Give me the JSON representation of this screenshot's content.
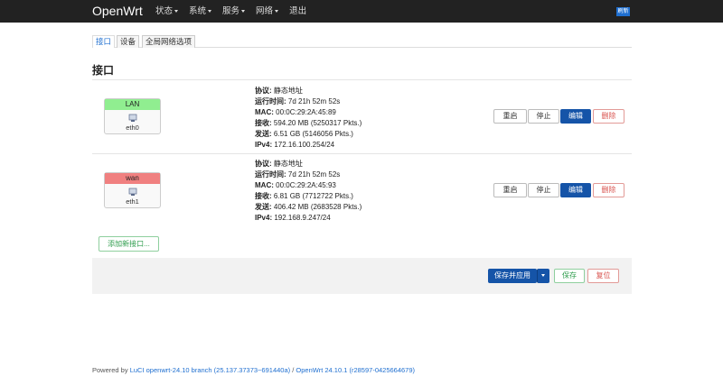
{
  "nav": {
    "brand": "OpenWrt",
    "menu": [
      {
        "label": "状态"
      },
      {
        "label": "系统"
      },
      {
        "label": "服务"
      },
      {
        "label": "网络"
      },
      {
        "label": "退出"
      }
    ],
    "indicator": "刷新"
  },
  "tabs": [
    "接口",
    "设备",
    "全局网络选项"
  ],
  "section_title": "接口",
  "interfaces": [
    {
      "name": "LAN",
      "device": "eth0",
      "color": "#90ee90",
      "protocol_label": "协议:",
      "protocol": "静态地址",
      "uptime_label": "运行时间:",
      "uptime": "7d 21h 52m 52s",
      "mac_label": "MAC:",
      "mac": "00:0C:29:2A:45:89",
      "rx_label": "接收:",
      "rx": "594.20 MB (5250317 Pkts.)",
      "tx_label": "发送:",
      "tx": "6.51 GB (5146056 Pkts.)",
      "ipv4_label": "IPv4:",
      "ipv4": "172.16.100.254/24"
    },
    {
      "name": "wan",
      "device": "eth1",
      "color": "#f08080",
      "protocol_label": "协议:",
      "protocol": "静态地址",
      "uptime_label": "运行时间:",
      "uptime": "7d 21h 52m 52s",
      "mac_label": "MAC:",
      "mac": "00:0C:29:2A:45:93",
      "rx_label": "接收:",
      "rx": "6.81 GB (7712722 Pkts.)",
      "tx_label": "发送:",
      "tx": "406.42 MB (2683528 Pkts.)",
      "ipv4_label": "IPv4:",
      "ipv4": "192.168.9.247/24"
    }
  ],
  "row_buttons": {
    "restart": "重启",
    "stop": "停止",
    "edit": "编辑",
    "delete": "删除"
  },
  "add_interface": "添加新接口...",
  "actions": {
    "save_apply": "保存并应用",
    "save": "保存",
    "reset": "复位"
  },
  "footer": {
    "prefix": "Powered by ",
    "luci": "LuCI openwrt-24.10 branch (25.137.37373~691440a)",
    "sep": " / ",
    "openwrt": "OpenWrt 24.10.1 (r28597-0425664679)"
  }
}
